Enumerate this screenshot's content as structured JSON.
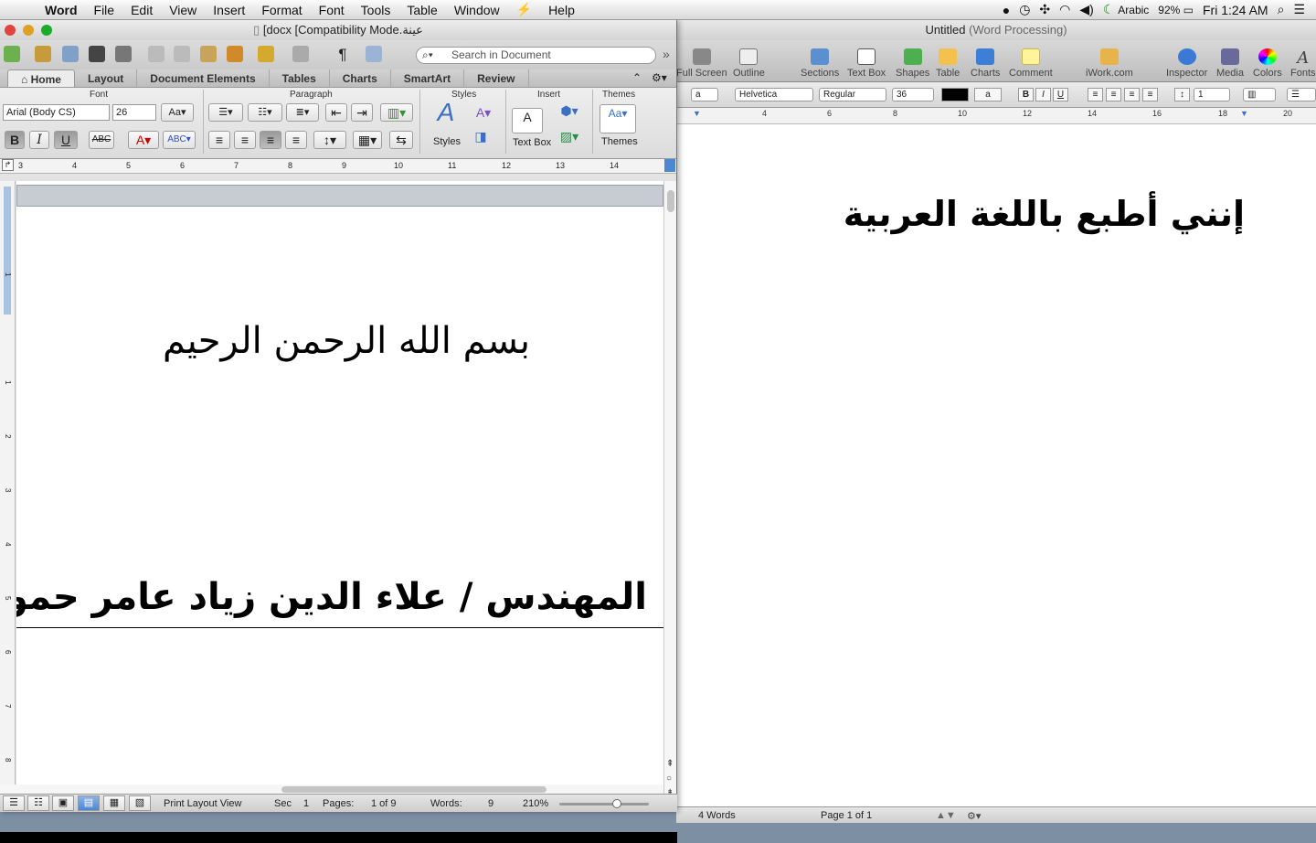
{
  "menubar": {
    "apple": "",
    "app": "Word",
    "items": [
      "File",
      "Edit",
      "View",
      "Insert",
      "Format",
      "Font",
      "Tools",
      "Table",
      "Window",
      "Help"
    ],
    "input_source": "Arabic",
    "battery": "92%",
    "clock": "Fri 1:24 AM"
  },
  "pages": {
    "title": "Untitled",
    "title_sub": "(Word Processing)",
    "toolbar": [
      "Full Screen",
      "Outline",
      "Sections",
      "Text Box",
      "Shapes",
      "Table",
      "Charts",
      "Comment",
      "iWork.com",
      "Inspector",
      "Media",
      "Colors",
      "Fonts"
    ],
    "format": {
      "style": "a",
      "font": "Helvetica",
      "typeface": "Regular",
      "size": "36",
      "line": "1"
    },
    "ruler": [
      "4",
      "6",
      "8",
      "10",
      "12",
      "14",
      "16",
      "18",
      "20"
    ],
    "body_text": "إنني أطبع باللغة العربية",
    "status": {
      "words": "4 Words",
      "page": "Page 1 of 1"
    }
  },
  "word": {
    "title": "[docx [Compatibility Mode.عينة",
    "search_placeholder": "Search in Document",
    "tabs": [
      "Home",
      "Layout",
      "Document Elements",
      "Tables",
      "Charts",
      "SmartArt",
      "Review"
    ],
    "groups": {
      "font": "Font",
      "paragraph": "Paragraph",
      "styles": "Styles",
      "insert": "Insert",
      "themes": "Themes"
    },
    "font_name": "Arial (Body CS)",
    "font_size": "26",
    "styles_label": "Styles",
    "textbox_label": "Text Box",
    "themes_label": "Themes",
    "ruler": [
      "3",
      "4",
      "5",
      "6",
      "7",
      "8",
      "9",
      "10",
      "11",
      "12",
      "13",
      "14"
    ],
    "vruler": [
      "1",
      "1",
      "2",
      "3",
      "4",
      "5",
      "6",
      "7",
      "8"
    ],
    "line1": "بسم الله الرحمن الرحيم",
    "line2": "المهندس / علاء الدين زياد عامر حمود:",
    "status": {
      "view": "Print Layout View",
      "sec_label": "Sec",
      "sec": "1",
      "pages_label": "Pages:",
      "pages": "1 of 9",
      "words_label": "Words:",
      "words": "9",
      "zoom": "210%"
    }
  }
}
